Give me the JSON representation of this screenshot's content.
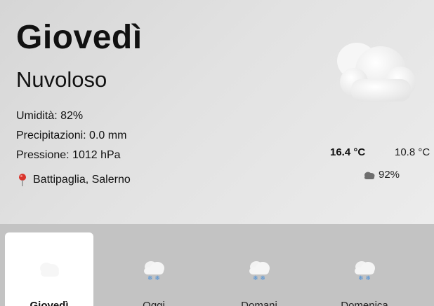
{
  "hero": {
    "day": "Giovedì",
    "condition": "Nuvoloso",
    "humidity": "Umidità: 82%",
    "precipitation": "Precipitazioni: 0.0 mm",
    "pressure": "Pressione: 1012 hPa",
    "location": "Battipaglia, Salerno",
    "icon": "cloud-icon",
    "temp_max": "16.4 °C",
    "temp_min": "10.8 °C",
    "cloud_cover": "92%"
  },
  "forecast": {
    "days": [
      {
        "label": "Giovedì",
        "icon": "cloud-icon",
        "selected": true
      },
      {
        "label": "Oggi",
        "icon": "snow-cloud-icon",
        "selected": false
      },
      {
        "label": "Domani",
        "icon": "snow-cloud-icon",
        "selected": false
      },
      {
        "label": "Domenica",
        "icon": "snow-cloud-icon",
        "selected": false
      }
    ]
  },
  "colors": {
    "pin": "#d9342b",
    "snowflake": "#4a90d9"
  }
}
